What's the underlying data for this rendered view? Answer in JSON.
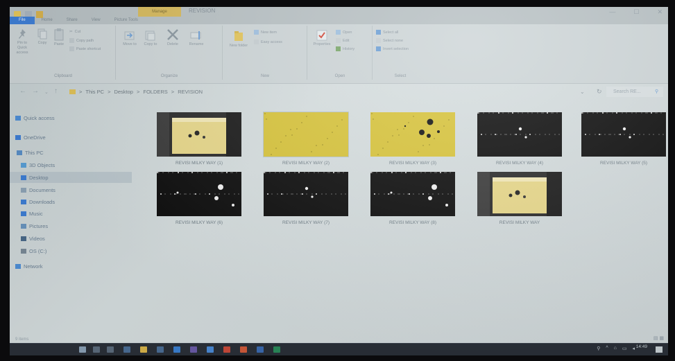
{
  "window": {
    "title": "REVISION",
    "context_tab": "Manage",
    "controls": [
      "—",
      "☐",
      "✕"
    ]
  },
  "ribbon_tabs": [
    "File",
    "Home",
    "Share",
    "View",
    "Picture Tools"
  ],
  "ribbon": {
    "clipboard": {
      "pin": "Pin to Quick access",
      "copy": "Copy",
      "paste": "Paste",
      "cut": "Cut",
      "copy_path": "Copy path",
      "paste_shortcut": "Paste shortcut",
      "label": "Clipboard"
    },
    "organize": {
      "move_to": "Move to",
      "copy_to": "Copy to",
      "delete": "Delete",
      "rename": "Rename",
      "label": "Organize"
    },
    "new": {
      "new_folder": "New folder",
      "new_item": "New item",
      "easy_access": "Easy access",
      "label": "New"
    },
    "open": {
      "properties": "Properties",
      "open": "Open",
      "edit": "Edit",
      "history": "History",
      "label": "Open"
    },
    "select": {
      "select_all": "Select all",
      "select_none": "Select none",
      "invert_selection": "Invert selection",
      "label": "Select"
    }
  },
  "address": {
    "crumbs": [
      "This PC",
      "Desktop",
      "FOLDERS",
      "REVISION"
    ],
    "separator": ">",
    "search_placeholder": "Search RE..."
  },
  "sidebar": {
    "items": [
      {
        "label": "Quick access",
        "icon": "star-icon",
        "color": "#4f8fd8"
      },
      {
        "label": "OneDrive",
        "icon": "cloud-icon",
        "color": "#3f7fd6"
      },
      {
        "label": "This PC",
        "icon": "computer-icon",
        "color": "#5a8fc8"
      },
      {
        "label": "3D Objects",
        "icon": "cube-icon",
        "color": "#5aa0d8"
      },
      {
        "label": "Desktop",
        "icon": "desktop-icon",
        "color": "#3f7fd6",
        "selected": true
      },
      {
        "label": "Documents",
        "icon": "document-icon",
        "color": "#8fa5b8"
      },
      {
        "label": "Downloads",
        "icon": "download-icon",
        "color": "#3f7fd6"
      },
      {
        "label": "Music",
        "icon": "music-icon",
        "color": "#3f7fd6"
      },
      {
        "label": "Pictures",
        "icon": "picture-icon",
        "color": "#6a96c0"
      },
      {
        "label": "Videos",
        "icon": "video-icon",
        "color": "#4a6a8a"
      },
      {
        "label": "OS (C:)",
        "icon": "drive-icon",
        "color": "#7a8a98"
      },
      {
        "label": "Network",
        "icon": "network-icon",
        "color": "#4f8fd8"
      }
    ]
  },
  "files": [
    {
      "name": "REVISI MILKY WAY (1)",
      "kind": "photo"
    },
    {
      "name": "REVISI MILKY WAY (2)",
      "kind": "yellow",
      "selected": true
    },
    {
      "name": "REVISI MILKY WAY (3)",
      "kind": "yellow-spots"
    },
    {
      "name": "REVISI MILKY WAY (4)",
      "kind": "dark"
    },
    {
      "name": "REVISI MILKY WAY (5)",
      "kind": "dark"
    },
    {
      "name": "REVISI MILKY WAY (6)",
      "kind": "dark-blobs"
    },
    {
      "name": "REVISI MILKY WAY (7)",
      "kind": "dark"
    },
    {
      "name": "REVISI MILKY WAY (8)",
      "kind": "dark-blobs"
    },
    {
      "name": "REVISI MILKY WAY",
      "kind": "photo"
    }
  ],
  "status": {
    "items": "9 items"
  },
  "taskbar": {
    "clock": "14:49"
  }
}
